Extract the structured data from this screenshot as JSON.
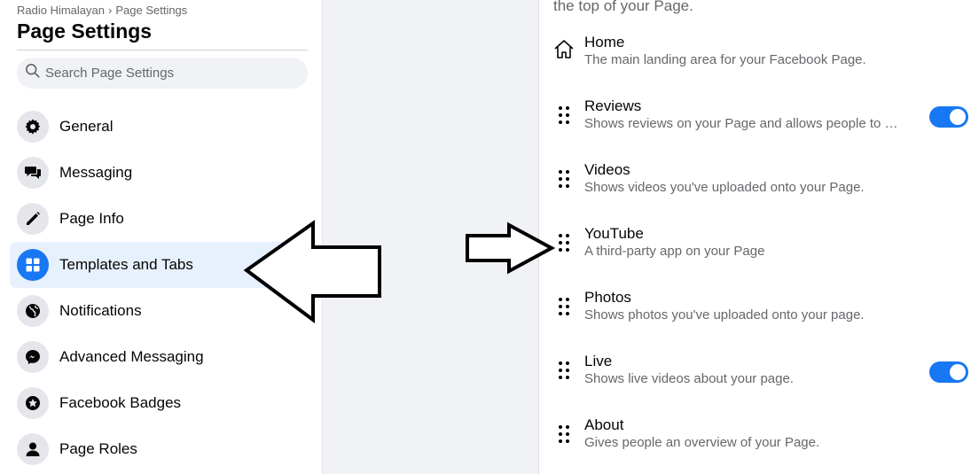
{
  "breadcrumb": {
    "parent": "Radio Himalayan",
    "separator": "›",
    "current": "Page Settings"
  },
  "page_title": "Page Settings",
  "search": {
    "placeholder": "Search Page Settings",
    "icon": "search-icon"
  },
  "sidebar": {
    "items": [
      {
        "label": "General",
        "icon": "gear-icon",
        "active": false
      },
      {
        "label": "Messaging",
        "icon": "messaging-icon",
        "active": false
      },
      {
        "label": "Page Info",
        "icon": "pencil-icon",
        "active": false
      },
      {
        "label": "Templates and Tabs",
        "icon": "grid-icon",
        "active": true
      },
      {
        "label": "Notifications",
        "icon": "globe-icon",
        "active": false
      },
      {
        "label": "Advanced Messaging",
        "icon": "messenger-icon",
        "active": false
      },
      {
        "label": "Facebook Badges",
        "icon": "badge-icon",
        "active": false
      },
      {
        "label": "Page Roles",
        "icon": "person-icon",
        "active": false
      }
    ]
  },
  "panel": {
    "intro_text": "the top of your Page.",
    "tabs": [
      {
        "title": "Home",
        "description": "The main landing area for your Facebook Page.",
        "handle": "home-icon",
        "toggle": null
      },
      {
        "title": "Reviews",
        "description": "Shows reviews on your Page and allows people to w...",
        "handle": "drag-handle-icon",
        "toggle": "on"
      },
      {
        "title": "Videos",
        "description": "Shows videos you've uploaded onto your Page.",
        "handle": "drag-handle-icon",
        "toggle": null
      },
      {
        "title": "YouTube",
        "description": "A third-party app on your Page",
        "handle": "drag-handle-icon",
        "toggle": null
      },
      {
        "title": "Photos",
        "description": "Shows photos you've uploaded onto your page.",
        "handle": "drag-handle-icon",
        "toggle": null
      },
      {
        "title": "Live",
        "description": "Shows live videos about your page.",
        "handle": "drag-handle-icon",
        "toggle": "on"
      },
      {
        "title": "About",
        "description": "Gives people an overview of your Page.",
        "handle": "drag-handle-icon",
        "toggle": null
      }
    ]
  },
  "colors": {
    "accent": "#1877f2",
    "active_bg": "#e7f0fd",
    "icon_bg": "#e4e6eb",
    "secondary_text": "#65676b",
    "gap_bg": "#f0f2f5"
  },
  "annotations": [
    {
      "name": "left-arrow-annotation",
      "direction": "left"
    },
    {
      "name": "right-arrow-annotation",
      "direction": "right"
    }
  ]
}
